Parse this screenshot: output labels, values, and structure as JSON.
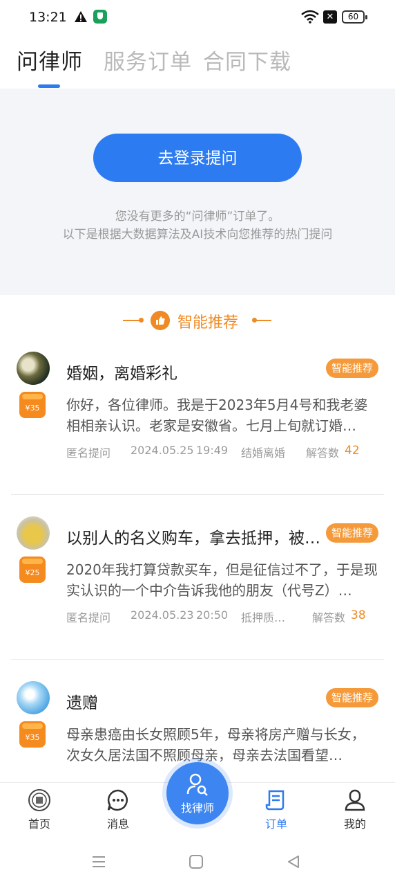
{
  "status_bar": {
    "time": "13:21",
    "battery": "60"
  },
  "tabs": [
    "问律师",
    "服务订单",
    "合同下载"
  ],
  "login_button": "去登录提问",
  "notes": [
    "您没有更多的“问律师”订单了。",
    "以下是根据大数据算法及AI技术向您推荐的热门提问"
  ],
  "recommend_title": "智能推荐",
  "cards": [
    {
      "title": "婚姻，离婚彩礼",
      "tag": "智能推荐",
      "reward": "¥35",
      "body": "你好，各位律师。我是于2023年5月4号和我老婆相相亲认识。老家是安徽省。七月上旬就订婚…",
      "author": "匿名提问",
      "date": "2024.05.25",
      "time": "19:49",
      "category": "结婚离婚",
      "answers_label": "解答数",
      "answers": "42"
    },
    {
      "title": "以别人的名义购车，拿去抵押，被…",
      "tag": "智能推荐",
      "reward": "¥25",
      "body": "2020年我打算贷款买车，但是征信过不了，于是现实认识的一个中介告诉我他的朋友（代号Z）…",
      "author": "匿名提问",
      "date": "2024.05.23",
      "time": "20:50",
      "category": "抵押质…",
      "answers_label": "解答数",
      "answers": "38"
    },
    {
      "title": "遗赠",
      "tag": "智能推荐",
      "reward": "¥35",
      "body": "母亲患癌由长女照顾5年，母亲将房产赠与长女，次女久居法国不照顾母亲，母亲去法国看望…",
      "author": "",
      "date": "",
      "time": "",
      "category": "",
      "answers_label": "",
      "answers": ""
    }
  ],
  "bottom_nav": {
    "home": "首页",
    "messages": "消息",
    "find_lawyer": "找律师",
    "orders": "订单",
    "mine": "我的"
  },
  "colors": {
    "accent": "#2d7bf0",
    "orange": "#f08a24"
  }
}
